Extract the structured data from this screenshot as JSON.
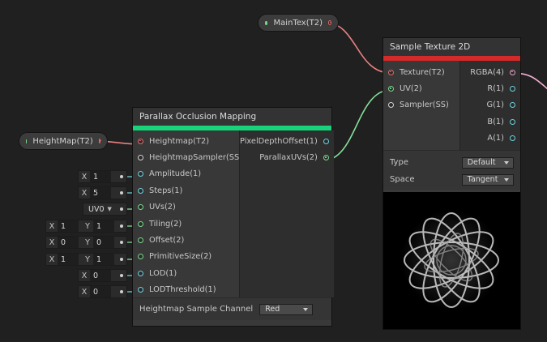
{
  "property_nodes": {
    "maintex": {
      "label": "MainTex(T2)"
    },
    "heightmap": {
      "label": "HeightMap(T2)"
    }
  },
  "pom_node": {
    "title": "Parallax Occlusion Mapping",
    "accent_color": "#17d37a",
    "inputs": [
      {
        "label": "Heightmap(T2)",
        "port_color": "red"
      },
      {
        "label": "HeightmapSampler(SS)",
        "port_color": "white"
      },
      {
        "label": "Amplitude(1)",
        "port_color": "cyan"
      },
      {
        "label": "Steps(1)",
        "port_color": "cyan"
      },
      {
        "label": "UVs(2)",
        "port_color": "green"
      },
      {
        "label": "Tiling(2)",
        "port_color": "green"
      },
      {
        "label": "Offset(2)",
        "port_color": "green"
      },
      {
        "label": "PrimitiveSize(2)",
        "port_color": "green"
      },
      {
        "label": "LOD(1)",
        "port_color": "cyan"
      },
      {
        "label": "LODThreshold(1)",
        "port_color": "cyan"
      }
    ],
    "outputs": [
      {
        "label": "PixelDepthOffset(1)",
        "port_color": "cyan"
      },
      {
        "label": "ParallaxUVs(2)",
        "port_color": "green"
      }
    ],
    "footer_label": "Heightmap Sample Channel",
    "footer_value": "Red"
  },
  "inline_fields": {
    "amplitude": {
      "x_label": "X",
      "x": "1"
    },
    "steps": {
      "x_label": "X",
      "x": "5"
    },
    "uvs": {
      "value": "UV0"
    },
    "tiling": {
      "x_label": "X",
      "x": "1",
      "y_label": "Y",
      "y": "1"
    },
    "offset": {
      "x_label": "X",
      "x": "0",
      "y_label": "Y",
      "y": "0"
    },
    "primitive_size": {
      "x_label": "X",
      "x": "1",
      "y_label": "Y",
      "y": "1"
    },
    "lod": {
      "x_label": "X",
      "x": "0"
    },
    "lod_threshold": {
      "x_label": "X",
      "x": "0"
    }
  },
  "sample_node": {
    "title": "Sample Texture 2D",
    "accent_color": "#d42a2a",
    "inputs": [
      {
        "label": "Texture(T2)",
        "port_color": "red"
      },
      {
        "label": "UV(2)",
        "port_color": "green"
      },
      {
        "label": "Sampler(SS)",
        "port_color": "white"
      }
    ],
    "outputs": [
      {
        "label": "RGBA(4)",
        "port_color": "pink"
      },
      {
        "label": "R(1)",
        "port_color": "cyan"
      },
      {
        "label": "G(1)",
        "port_color": "cyan"
      },
      {
        "label": "B(1)",
        "port_color": "cyan"
      },
      {
        "label": "A(1)",
        "port_color": "cyan"
      }
    ],
    "type_label": "Type",
    "type_value": "Default",
    "space_label": "Space",
    "space_value": "Tangent"
  },
  "colors": {
    "background": "#202020",
    "wire_red": "#e88080",
    "wire_green": "#86e098",
    "wire_pink": "#f0b0d0"
  }
}
